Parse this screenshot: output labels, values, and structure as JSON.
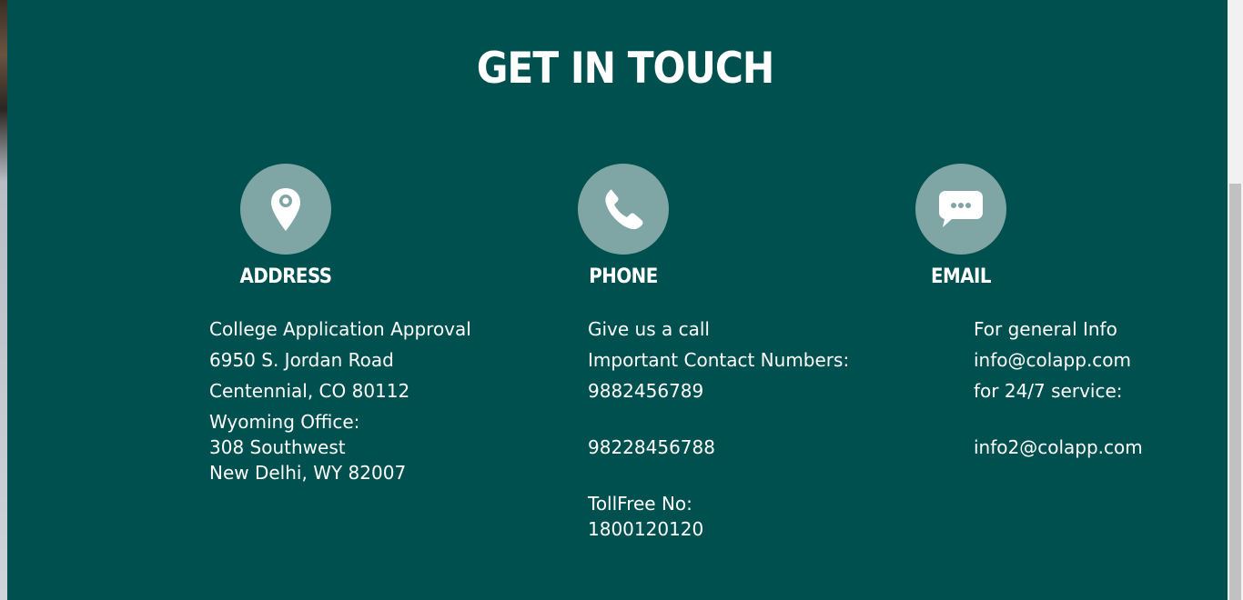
{
  "section": {
    "title": "GET IN TOUCH"
  },
  "address": {
    "heading": "ADDRESS",
    "icon": "map-pin-icon",
    "lines": [
      "College Application Approval",
      "6950 S. Jordan Road",
      "Centennial, CO 80112",
      "Wyoming Office:",
      "308 Southwest",
      "New Delhi, WY 82007"
    ]
  },
  "phone": {
    "heading": "PHONE",
    "icon": "phone-icon",
    "lines": [
      "Give us a call",
      "Important Contact Numbers:",
      "9882456789",
      "98228456788",
      "TollFree No:",
      "1800120120"
    ]
  },
  "email": {
    "heading": "EMAIL",
    "icon": "chat-bubble-icon",
    "lines": [
      "For general Info",
      "info@colapp.com",
      "for 24/7 service:",
      "info2@colapp.com"
    ]
  },
  "colors": {
    "background": "#00504f",
    "icon_circle": "#7fa6a5",
    "text": "#ffffff"
  }
}
